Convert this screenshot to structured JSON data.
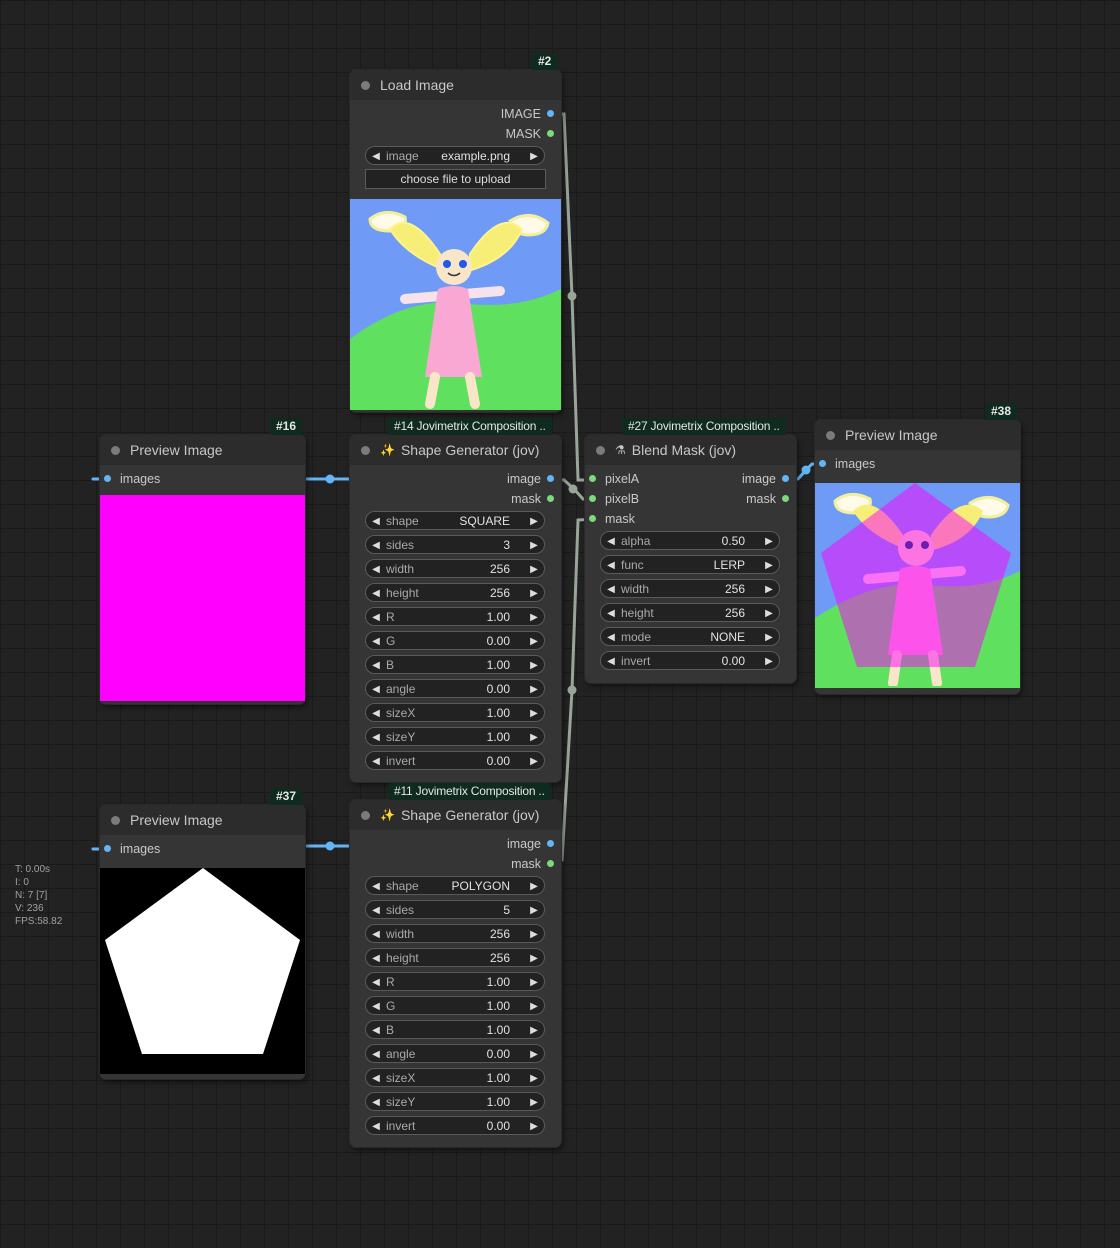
{
  "nodes": {
    "load_image": {
      "badge": "#2",
      "title": "Load Image",
      "outputs": [
        "IMAGE",
        "MASK"
      ],
      "image_widget": {
        "label": "image",
        "value": "example.png"
      },
      "upload_label": "choose file to upload"
    },
    "preview16": {
      "badge": "#16",
      "title": "Preview Image",
      "input": "images"
    },
    "preview37": {
      "badge": "#37",
      "title": "Preview Image",
      "input": "images"
    },
    "preview38": {
      "badge": "#38",
      "title": "Preview Image",
      "input": "images"
    },
    "shape14": {
      "badge": "#14 Jovimetrix Composition ..",
      "title": "Shape Generator (jov)",
      "outputs": [
        "image",
        "mask"
      ],
      "widgets": [
        {
          "label": "shape",
          "value": "SQUARE"
        },
        {
          "label": "sides",
          "value": "3"
        },
        {
          "label": "width",
          "value": "256"
        },
        {
          "label": "height",
          "value": "256"
        },
        {
          "label": "R",
          "value": "1.00"
        },
        {
          "label": "G",
          "value": "0.00"
        },
        {
          "label": "B",
          "value": "1.00"
        },
        {
          "label": "angle",
          "value": "0.00"
        },
        {
          "label": "sizeX",
          "value": "1.00"
        },
        {
          "label": "sizeY",
          "value": "1.00"
        },
        {
          "label": "invert",
          "value": "0.00"
        }
      ]
    },
    "shape11": {
      "badge": "#11 Jovimetrix Composition ..",
      "title": "Shape Generator (jov)",
      "outputs": [
        "image",
        "mask"
      ],
      "widgets": [
        {
          "label": "shape",
          "value": "POLYGON"
        },
        {
          "label": "sides",
          "value": "5"
        },
        {
          "label": "width",
          "value": "256"
        },
        {
          "label": "height",
          "value": "256"
        },
        {
          "label": "R",
          "value": "1.00"
        },
        {
          "label": "G",
          "value": "1.00"
        },
        {
          "label": "B",
          "value": "1.00"
        },
        {
          "label": "angle",
          "value": "0.00"
        },
        {
          "label": "sizeX",
          "value": "1.00"
        },
        {
          "label": "sizeY",
          "value": "1.00"
        },
        {
          "label": "invert",
          "value": "0.00"
        }
      ]
    },
    "blend27": {
      "badge": "#27 Jovimetrix Composition ..",
      "title": "Blend Mask (jov)",
      "inputs": [
        "pixelA",
        "pixelB",
        "mask"
      ],
      "outputs": [
        "image",
        "mask"
      ],
      "widgets": [
        {
          "label": "alpha",
          "value": "0.50"
        },
        {
          "label": "func",
          "value": "LERP"
        },
        {
          "label": "width",
          "value": "256"
        },
        {
          "label": "height",
          "value": "256"
        },
        {
          "label": "mode",
          "value": "NONE"
        },
        {
          "label": "invert",
          "value": "0.00"
        }
      ]
    }
  },
  "stats": [
    "T: 0.00s",
    "I: 0",
    "N: 7 [7]",
    "V: 236",
    "FPS:58.82"
  ],
  "colors": {
    "canvas": "#222222",
    "node_body": "#353535",
    "node_title": "#2c2c2c",
    "badge_bg": "#0f2a1e",
    "image_slot": "#64b5f6",
    "mask_slot": "#7cda7c",
    "magenta": "#ff00ff"
  }
}
